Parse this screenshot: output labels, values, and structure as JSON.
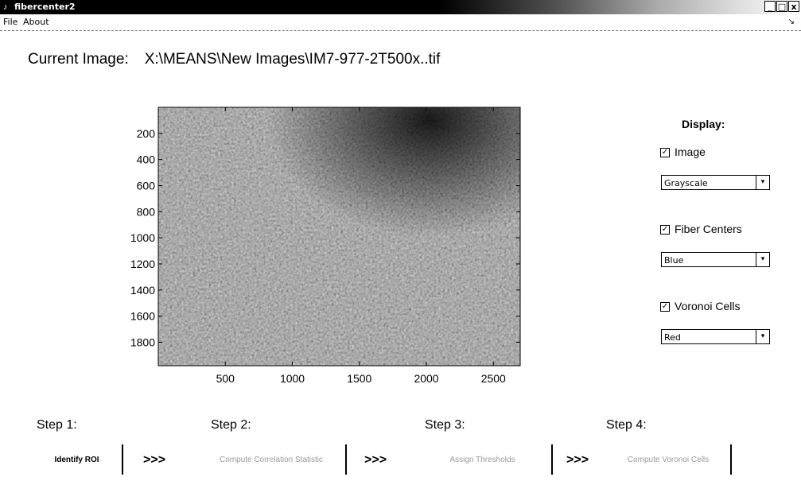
{
  "window": {
    "title": "fibercenter2",
    "buttons": [
      "_",
      "□",
      "x"
    ]
  },
  "menu": {
    "items": [
      "File",
      "About"
    ]
  },
  "header": {
    "label": "Current Image:",
    "path": "X:\\MEANS\\New Images\\IM7-977-2T500x..tif"
  },
  "chart_data": {
    "type": "heatmap",
    "title": "",
    "xlabel": "",
    "ylabel": "",
    "xlim": [
      0,
      2700
    ],
    "ylim": [
      1980,
      0
    ],
    "x_ticks": [
      500,
      1000,
      1500,
      2000,
      2500
    ],
    "y_ticks": [
      200,
      400,
      600,
      800,
      1000,
      1200,
      1400,
      1600,
      1800
    ],
    "y_inverted": true,
    "grid": false,
    "colormap": "grayscale"
  },
  "display": {
    "title": "Display:",
    "image": {
      "label": "Image",
      "checked": true,
      "option": "Grayscale"
    },
    "fiber_centers": {
      "label": "Fiber Centers",
      "checked": true,
      "option": "Blue"
    },
    "voronoi_cells": {
      "label": "Voronoi Cells",
      "checked": true,
      "option": "Red"
    }
  },
  "steps": [
    {
      "label": "Step 1:",
      "button": "Identify ROI",
      "enabled": true
    },
    {
      "label": "Step 2:",
      "button": "Compute Correlation Statistic",
      "enabled": false
    },
    {
      "label": "Step 3:",
      "button": "Assign Thresholds",
      "enabled": false
    },
    {
      "label": "Step 4:",
      "button": "Compute Voronoi Cells",
      "enabled": false
    }
  ],
  "arrow_text": ">>>"
}
